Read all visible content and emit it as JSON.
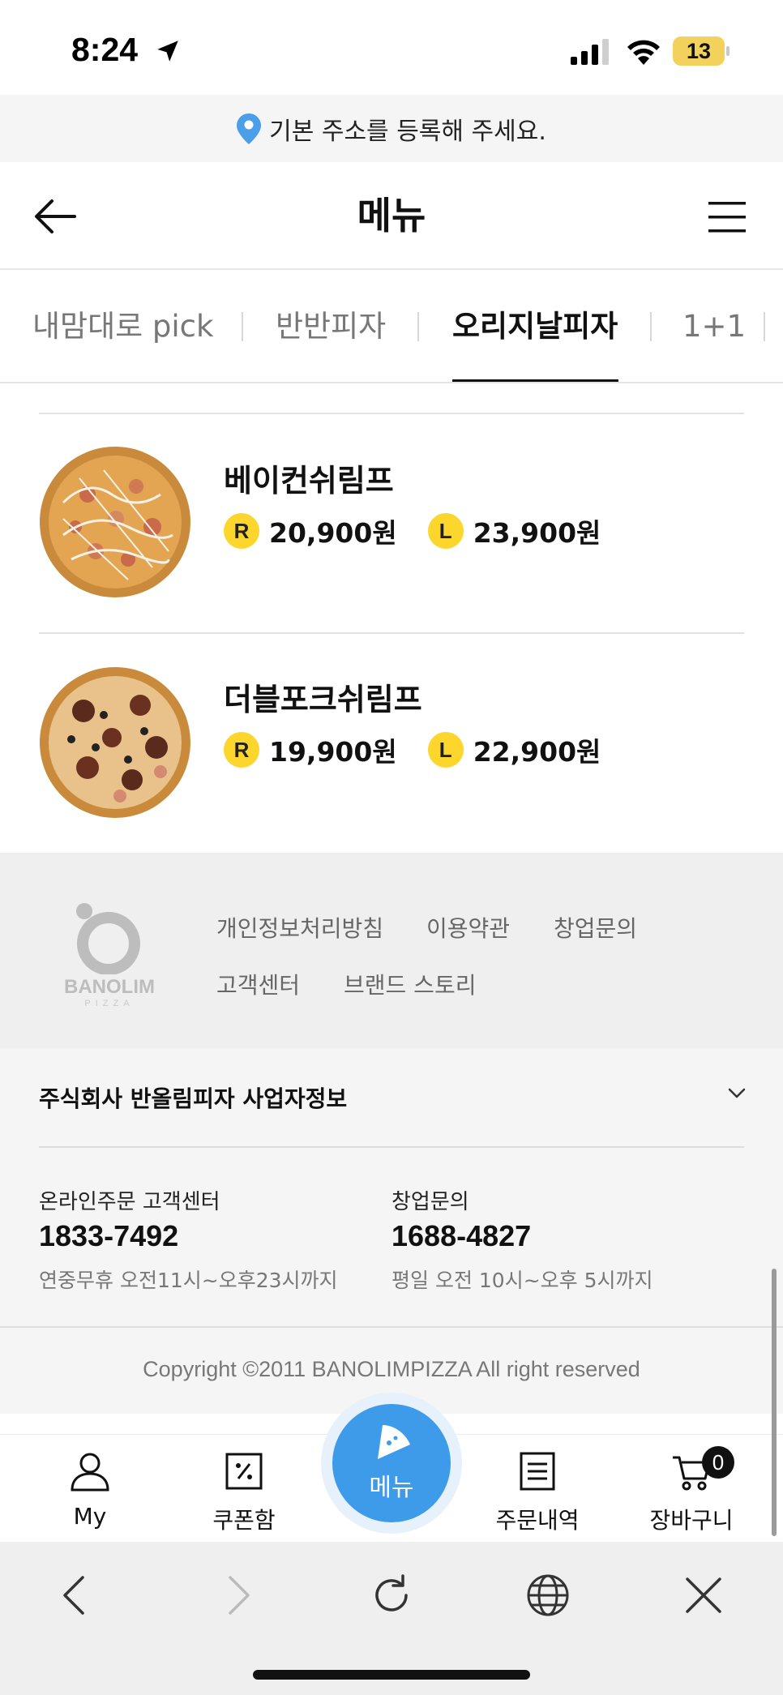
{
  "status_bar": {
    "time": "8:24",
    "battery": "13"
  },
  "address_banner": {
    "text": "기본 주소를 등록해 주세요."
  },
  "header": {
    "title": "메뉴"
  },
  "tabs": [
    {
      "label": "내맘대로 pick",
      "active": false
    },
    {
      "label": "반반피자",
      "active": false
    },
    {
      "label": "오리지날피자",
      "active": true
    },
    {
      "label": "1+1",
      "active": false
    }
  ],
  "menu_items": [
    {
      "name": "베이컨쉬림프",
      "prices": [
        {
          "size": "R",
          "price": "20,900원"
        },
        {
          "size": "L",
          "price": "23,900원"
        }
      ]
    },
    {
      "name": "더블포크쉬림프",
      "prices": [
        {
          "size": "R",
          "price": "19,900원"
        },
        {
          "size": "L",
          "price": "22,900원"
        }
      ]
    }
  ],
  "footer": {
    "logo_text": "BANOLIM",
    "logo_sub": "PIZZA",
    "links": [
      "개인정보처리방침",
      "이용약관",
      "창업문의",
      "고객센터",
      "브랜드 스토리"
    ]
  },
  "business_info": {
    "title": "주식회사 반올림피자 사업자정보",
    "contacts": [
      {
        "label": "온라인주문 고객센터",
        "phone": "1833-7492",
        "hours": "연중무휴 오전11시~오후23시까지"
      },
      {
        "label": "창업문의",
        "phone": "1688-4827",
        "hours": "평일 오전 10시~오후 5시까지"
      }
    ],
    "copyright": "Copyright ©2011 BANOLIMPIZZA All right reserved"
  },
  "bottom_nav": {
    "items": [
      {
        "label": "My",
        "icon": "person-icon"
      },
      {
        "label": "쿠폰함",
        "icon": "coupon-icon"
      },
      {
        "label": "메뉴",
        "icon": "pizza-slice-icon"
      },
      {
        "label": "주문내역",
        "icon": "receipt-icon"
      },
      {
        "label": "장바구니",
        "icon": "cart-icon"
      }
    ],
    "cart_count": "0"
  },
  "colors": {
    "accent_blue": "#3d9be9",
    "size_badge_yellow": "#fcd62d",
    "location_pin": "#4a9fe8"
  }
}
